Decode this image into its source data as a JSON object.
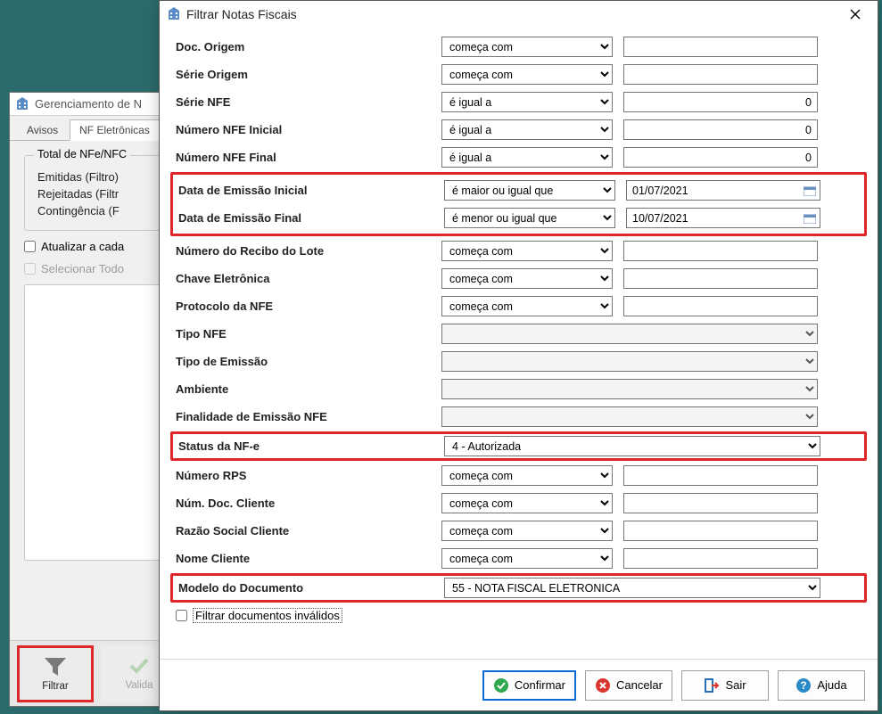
{
  "parent": {
    "title": "Gerenciamento de N",
    "tabs": [
      "Avisos",
      "NF Eletrônicas"
    ],
    "active_tab": 1,
    "group_title": "Total de NFe/NFC",
    "stats": {
      "emitidas": "Emitidas (Filtro)",
      "rejeitadas": "Rejeitadas (Filtr",
      "contingencia": "Contingência (F"
    },
    "atualizar_label": "Atualizar a cada",
    "selecionar_label": "Selecionar Todo",
    "toolbar": {
      "filtrar": "Filtrar",
      "validar": "Valida"
    }
  },
  "dialog": {
    "title": "Filtrar Notas Fiscais",
    "rows": {
      "doc_origem": {
        "label": "Doc. Origem",
        "op": "começa com",
        "value": ""
      },
      "serie_origem": {
        "label": "Série Origem",
        "op": "começa com",
        "value": ""
      },
      "serie_nfe": {
        "label": "Série NFE",
        "op": "é igual a",
        "value": "0"
      },
      "num_nfe_ini": {
        "label": "Número NFE Inicial",
        "op": "é igual a",
        "value": "0"
      },
      "num_nfe_fin": {
        "label": "Número NFE Final",
        "op": "é igual a",
        "value": "0"
      },
      "data_emi_ini": {
        "label": "Data de Emissão Inicial",
        "op": "é maior ou igual que",
        "value": "01/07/2021"
      },
      "data_emi_fin": {
        "label": "Data de Emissão Final",
        "op": "é menor ou igual que",
        "value": "10/07/2021"
      },
      "num_recibo": {
        "label": "Número do Recibo do Lote",
        "op": "começa com",
        "value": ""
      },
      "chave": {
        "label": "Chave Eletrônica",
        "op": "começa com",
        "value": ""
      },
      "protocolo": {
        "label": "Protocolo da NFE",
        "op": "começa com",
        "value": ""
      },
      "tipo_nfe": {
        "label": "Tipo NFE",
        "wide": ""
      },
      "tipo_emissao": {
        "label": "Tipo de Emissão",
        "wide": ""
      },
      "ambiente": {
        "label": "Ambiente",
        "wide": ""
      },
      "finalidade": {
        "label": "Finalidade de Emissão NFE",
        "wide": ""
      },
      "status": {
        "label": "Status da NF-e",
        "wide": "4 - Autorizada"
      },
      "num_rps": {
        "label": "Número RPS",
        "op": "começa com",
        "value": ""
      },
      "num_doc_cli": {
        "label": "Núm. Doc. Cliente",
        "op": "começa com",
        "value": ""
      },
      "razao": {
        "label": "Razão Social Cliente",
        "op": "começa com",
        "value": ""
      },
      "nome": {
        "label": "Nome Cliente",
        "op": "começa com",
        "value": ""
      },
      "modelo": {
        "label": "Modelo do Documento",
        "wide": "55 - NOTA FISCAL ELETRONICA"
      }
    },
    "filtrar_invalidos": "Filtrar documentos inválidos",
    "buttons": {
      "confirmar": "Confirmar",
      "cancelar": "Cancelar",
      "sair": "Sair",
      "ajuda": "Ajuda"
    }
  }
}
